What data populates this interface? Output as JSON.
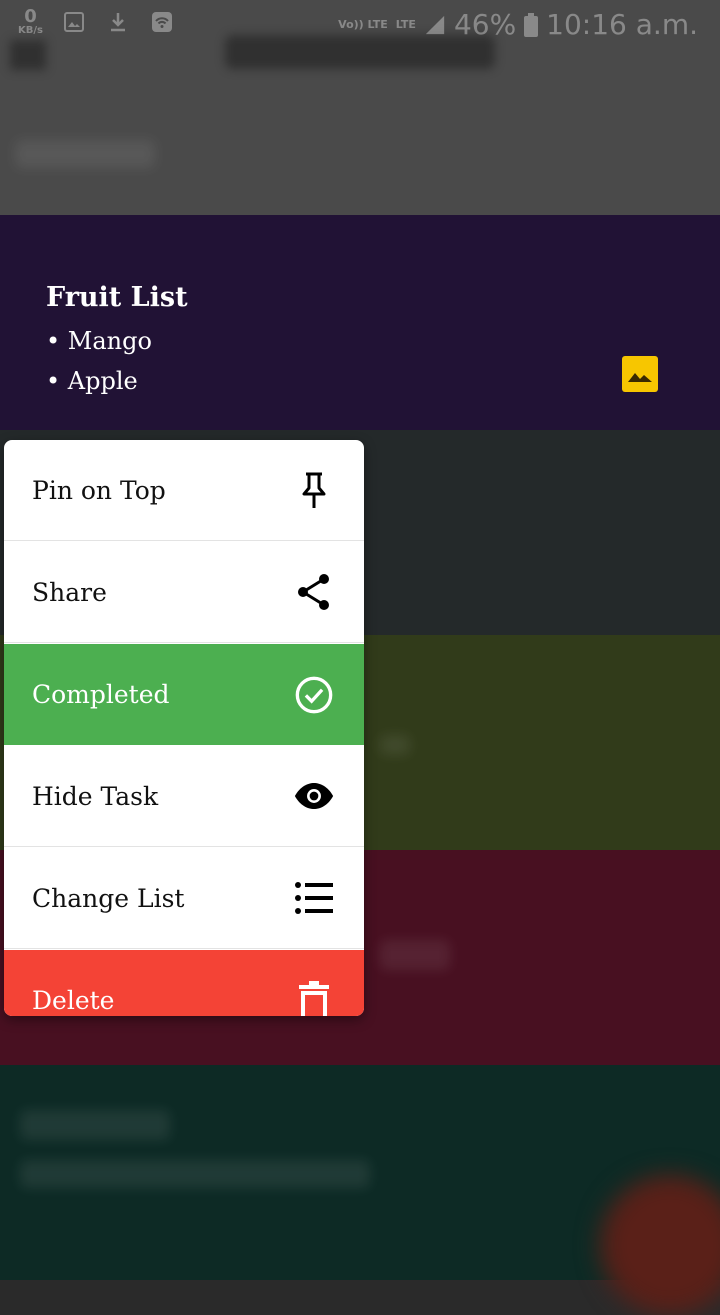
{
  "status_bar": {
    "net_speed_value": "0",
    "net_speed_unit": "KB/s",
    "volte": "Vo)) LTE",
    "lte": "LTE",
    "battery": "46%",
    "time": "10:16 a.m."
  },
  "card": {
    "title": "Fruit List",
    "items": [
      "• Mango",
      "• Apple"
    ]
  },
  "menu": {
    "items": [
      {
        "label": "Pin on Top",
        "icon": "pin-icon"
      },
      {
        "label": "Share",
        "icon": "share-icon"
      },
      {
        "label": "Completed",
        "icon": "check-circle-icon"
      },
      {
        "label": "Hide Task",
        "icon": "eye-icon"
      },
      {
        "label": "Change List",
        "icon": "list-icon"
      },
      {
        "label": "Delete",
        "icon": "trash-icon"
      }
    ]
  },
  "colors": {
    "completed": "#4caf50",
    "delete": "#f44336",
    "image_badge": "#f7c600"
  }
}
